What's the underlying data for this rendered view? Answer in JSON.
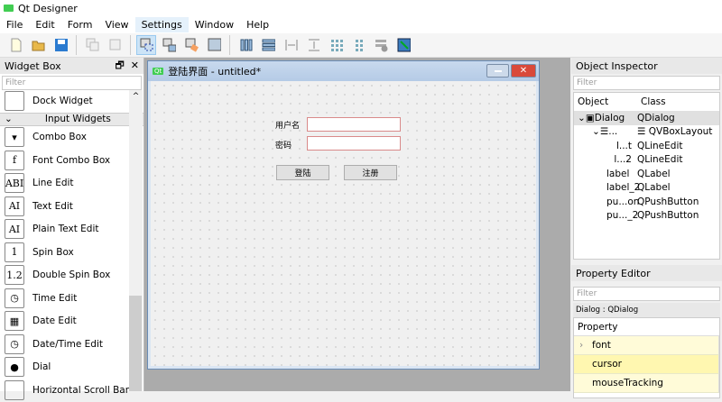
{
  "app": {
    "title": "Qt Designer"
  },
  "menu": [
    "File",
    "Edit",
    "Form",
    "View",
    "Settings",
    "Window",
    "Help"
  ],
  "active_menu": "Settings",
  "widget_box": {
    "title": "Widget Box",
    "filter_placeholder": "Filter",
    "items_before": [
      {
        "label": "Dock Widget",
        "icon": "dock-widget-icon"
      }
    ],
    "category": "Input Widgets",
    "items": [
      {
        "label": "Combo Box",
        "icon": "combo-box-icon",
        "glyph": "▾"
      },
      {
        "label": "Font Combo Box",
        "icon": "font-combo-box-icon",
        "glyph": "f"
      },
      {
        "label": "Line Edit",
        "icon": "line-edit-icon",
        "glyph": "ABI"
      },
      {
        "label": "Text Edit",
        "icon": "text-edit-icon",
        "glyph": "AI"
      },
      {
        "label": "Plain Text Edit",
        "icon": "plain-text-edit-icon",
        "glyph": "AI"
      },
      {
        "label": "Spin Box",
        "icon": "spin-box-icon",
        "glyph": "1"
      },
      {
        "label": "Double Spin Box",
        "icon": "double-spin-box-icon",
        "glyph": "1.2"
      },
      {
        "label": "Time Edit",
        "icon": "clock-icon",
        "glyph": "◷"
      },
      {
        "label": "Date Edit",
        "icon": "calendar-icon",
        "glyph": "▦"
      },
      {
        "label": "Date/Time Edit",
        "icon": "calendar-clock-icon",
        "glyph": "◷"
      },
      {
        "label": "Dial",
        "icon": "dial-icon",
        "glyph": "●"
      },
      {
        "label": "Horizontal Scroll Bar",
        "icon": "scroll-bar-icon",
        "glyph": ""
      }
    ]
  },
  "form": {
    "title": "登陆界面 - untitled*",
    "qt_badge": "Qt",
    "username_label": "用户名",
    "password_label": "密码",
    "username_value": "",
    "password_value": "",
    "login_button": "登陆",
    "register_button": "注册"
  },
  "object_inspector": {
    "title": "Object Inspector",
    "filter_placeholder": "Filter",
    "columns": [
      "Object",
      "Class"
    ],
    "rows": [
      {
        "object": "Dialog",
        "class": "QDialog",
        "indent": 0,
        "expanded": true,
        "selected": true
      },
      {
        "object": "...",
        "class": "QVBoxLayout",
        "indent": 1,
        "expanded": true
      },
      {
        "object": "l...t",
        "class": "QLineEdit",
        "indent": 2
      },
      {
        "object": "l...2",
        "class": "QLineEdit",
        "indent": 2
      },
      {
        "object": "label",
        "class": "QLabel",
        "indent": 1
      },
      {
        "object": "label_2",
        "class": "QLabel",
        "indent": 1
      },
      {
        "object": "pu...on",
        "class": "QPushButton",
        "indent": 1
      },
      {
        "object": "pu..._2",
        "class": "QPushButton",
        "indent": 1
      }
    ]
  },
  "property_editor": {
    "title": "Property Editor",
    "filter_placeholder": "Filter",
    "context": "Dialog : QDialog",
    "column": "Property",
    "rows": [
      {
        "name": "font",
        "expandable": true
      },
      {
        "name": "cursor"
      },
      {
        "name": "mouseTracking"
      }
    ]
  }
}
